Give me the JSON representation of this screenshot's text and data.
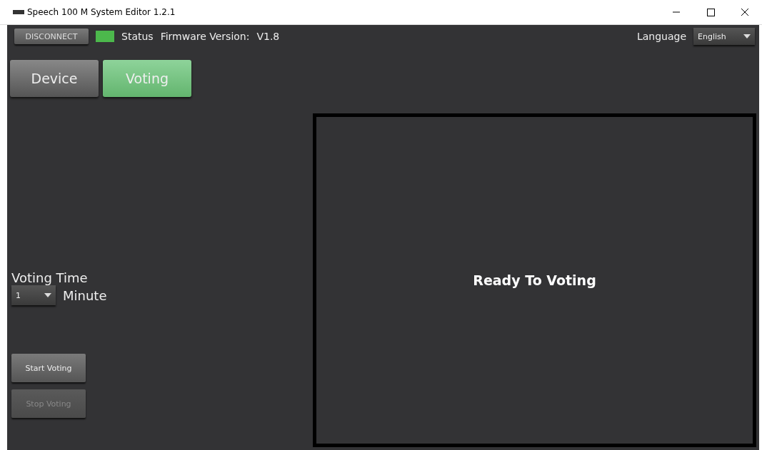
{
  "window": {
    "title": "Speech 100 M System Editor 1.2.1"
  },
  "toolbar": {
    "disconnect": "DISCONNECT",
    "status": {
      "label": "Status",
      "color": "#4cb84c"
    },
    "firmware_label": "Firmware Version:",
    "firmware_value": "V1.8",
    "language_label": "Language",
    "language": "English"
  },
  "tabs": [
    {
      "label": "Device",
      "selected": false
    },
    {
      "label": "Voting",
      "selected": true
    }
  ],
  "voting_time": {
    "label": "Voting Time",
    "value": "1",
    "unit": "Minute"
  },
  "buttons": [
    {
      "label": "Start Voting",
      "disabled": false
    },
    {
      "label": "Stop Voting",
      "disabled": true
    }
  ],
  "display": {
    "message": "Ready To Voting"
  }
}
